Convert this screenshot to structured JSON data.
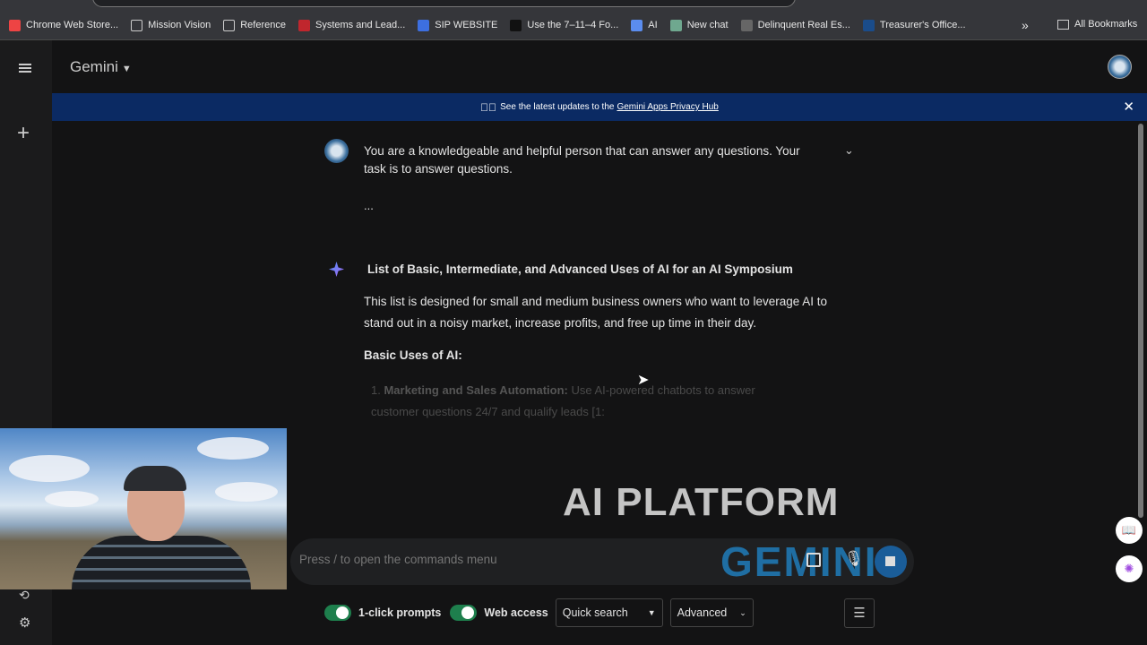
{
  "bookmarks": [
    {
      "label": "Chrome Web Store...",
      "color": "#e44"
    },
    {
      "label": "Mission Vision",
      "folder": true
    },
    {
      "label": "Reference",
      "folder": true
    },
    {
      "label": "Systems and Lead...",
      "color": "#c0262d"
    },
    {
      "label": "SIP WEBSITE",
      "color": "#3d6fe0"
    },
    {
      "label": "Use the 7–11–4 Fo...",
      "color": "#111"
    },
    {
      "label": "AI",
      "color": "#5b8def"
    },
    {
      "label": "New chat",
      "color": "#6fa88f"
    },
    {
      "label": "Delinquent Real Es...",
      "color": "#666"
    },
    {
      "label": "Treasurer's Office...",
      "color": "#1a4c8a"
    }
  ],
  "bookmarks_more": "»",
  "all_bookmarks": "All Bookmarks",
  "app": {
    "title": "Gemini"
  },
  "banner": {
    "text": "See the latest updates to the",
    "link": "Gemini Apps Privacy Hub"
  },
  "chat": {
    "prompt": "You are a knowledgeable and helpful person that can answer any questions. Your task is to answer questions.",
    "prompt_more": "...",
    "response_title": "List of Basic, Intermediate, and Advanced Uses of AI for an AI Symposium",
    "response_intro": "This list is designed for small and medium business owners who want to leverage AI to stand out in a noisy market, increase profits, and free up time in their day.",
    "section": "Basic Uses of AI:",
    "items": [
      {
        "num": "1.",
        "title": "Marketing and Sales Automation:",
        "text": "Use AI-powered chatbots to answer customer questions 24/7 and qualify leads [1:"
      }
    ]
  },
  "overlay": {
    "watermark_top": "AI PLATFORM",
    "watermark_bottom": "GEMINI"
  },
  "input": {
    "placeholder": "Press / to open the commands menu",
    "value": ""
  },
  "toolbar": {
    "one_click_prompts": {
      "label": "1-click prompts",
      "on": true
    },
    "web_access": {
      "label": "Web access",
      "on": true
    },
    "search_mode": "Quick search",
    "advanced": "Advanced"
  }
}
